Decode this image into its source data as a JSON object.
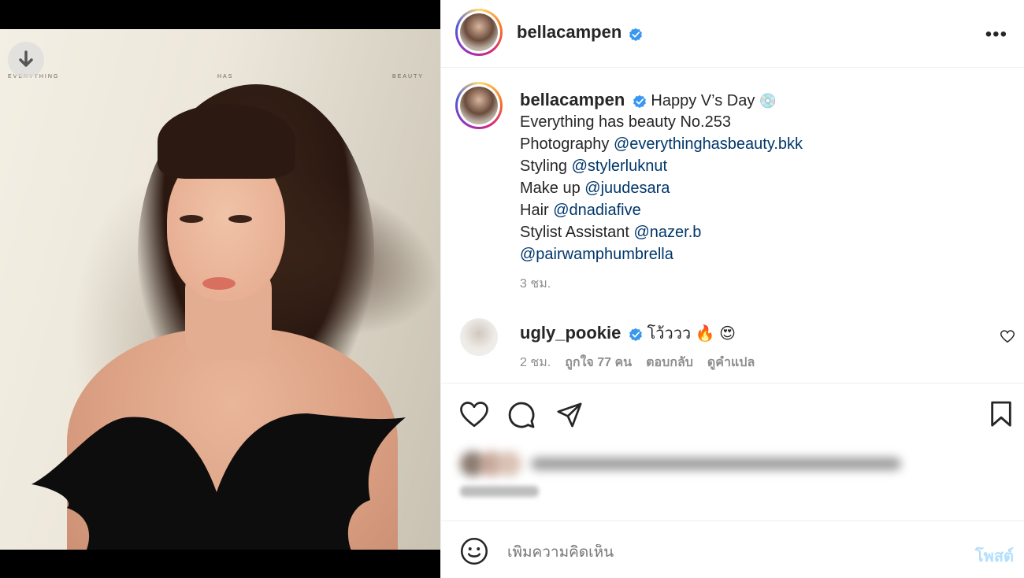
{
  "media": {
    "photo_words": [
      "EVERYTHING",
      "HAS",
      "BEAUTY"
    ],
    "download_icon": "download-arrow-icon"
  },
  "header": {
    "username": "bellacampen",
    "verified_icon": "verified-badge-icon",
    "more_icon": "more-options-icon",
    "more_label": "•••"
  },
  "caption": {
    "username": "bellacampen",
    "first_line": "Happy V’s Day",
    "emoji": "💿",
    "lines": [
      {
        "prefix": "Everything has beauty No.253",
        "mention": ""
      },
      {
        "prefix": "Photography ",
        "mention": "@everythinghasbeauty.bkk"
      },
      {
        "prefix": "Styling ",
        "mention": "@stylerluknut"
      },
      {
        "prefix": "Make up ",
        "mention": "@juudesara"
      },
      {
        "prefix": "Hair ",
        "mention": "@dnadiafive"
      },
      {
        "prefix": "Stylist Assistant ",
        "mention": "@nazer.b"
      },
      {
        "prefix": "",
        "mention": "@pairwamphumbrella"
      }
    ],
    "time": "3 ชม."
  },
  "comment": {
    "username": "ugly_pookie",
    "text": "โว้ววว",
    "emojis": "🔥 😍",
    "time": "2 ชม.",
    "likes": "ถูกใจ 77 คน",
    "reply": "ตอบกลับ",
    "translate": "ดูคำแปล",
    "like_icon": "heart-small-icon"
  },
  "actions": {
    "like_icon": "heart-icon",
    "comment_icon": "comment-icon",
    "share_icon": "send-icon",
    "save_icon": "bookmark-icon"
  },
  "composer": {
    "emoji_icon": "smiley-icon",
    "placeholder": "เพิ่มความคิดเห็น",
    "post_label": "โพสต์"
  },
  "colors": {
    "text": "#262626",
    "mention": "#00376b",
    "muted": "#8e8e8e",
    "verified": "#3897f0",
    "post_disabled": "#b2dffc"
  }
}
